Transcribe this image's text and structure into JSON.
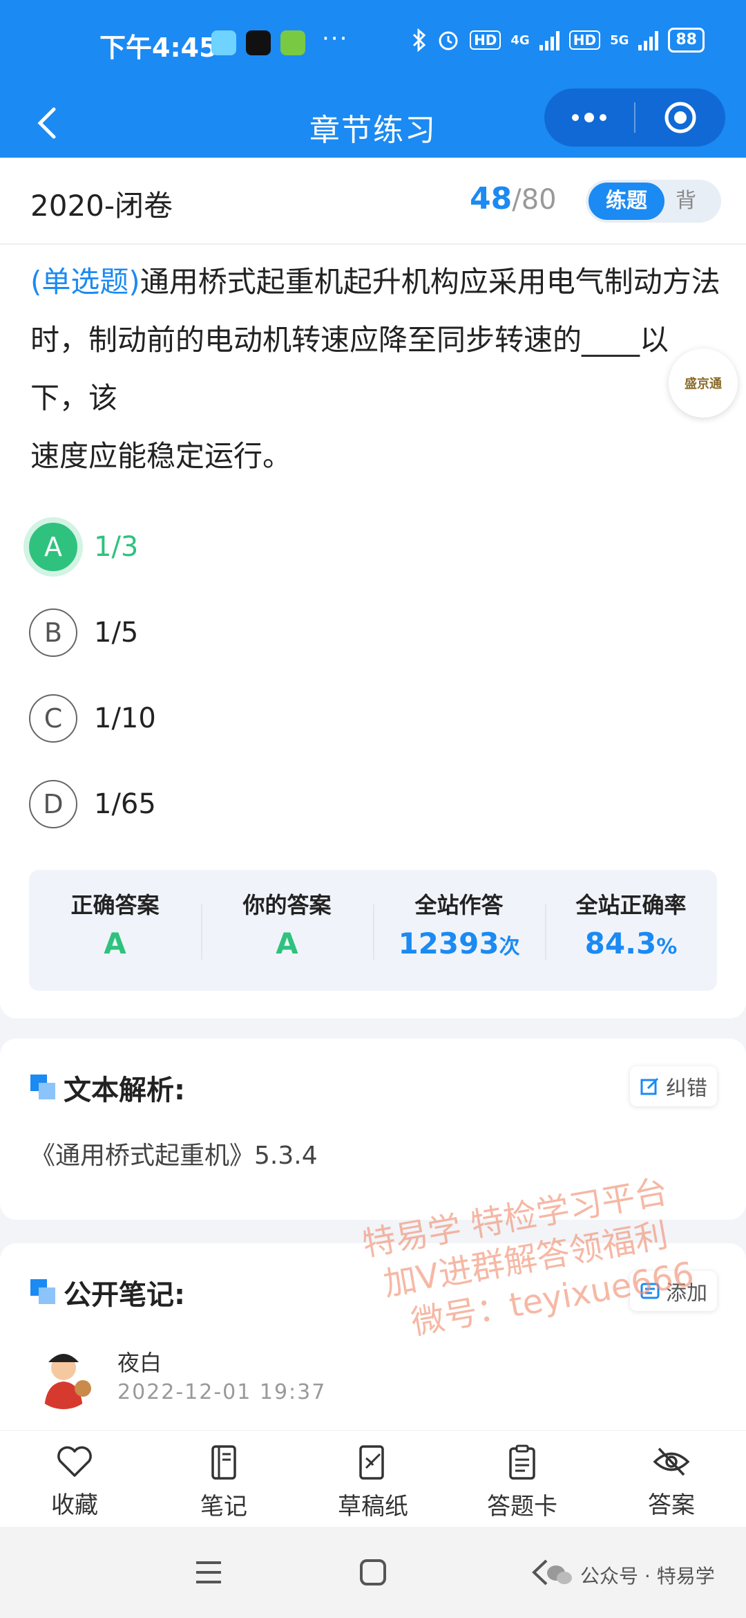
{
  "status_bar": {
    "time": "下午4:45",
    "dots": "···",
    "hd1": "HD",
    "net1": "4G",
    "hd2": "HD",
    "net2": "5G",
    "battery": "88"
  },
  "header": {
    "title": "章节练习",
    "back_icon": "chevron-left-icon",
    "more_icon": "more-dots-icon",
    "close_icon": "target-icon"
  },
  "subheader": {
    "paper_title": "2020-闭卷",
    "current": "48",
    "separator": "/",
    "total": "80",
    "mode_active": "练题",
    "mode_inactive": "背"
  },
  "question": {
    "type": "(单选题)",
    "text": "通用桥式起重机起升机构应采用电气制动方法时，制动前的电动机转速应降至同步转速的____以下，该",
    "text_line2": "速度应能稳定运行。"
  },
  "floating_badge": "盛京通",
  "options": [
    {
      "letter": "A",
      "text": "1/3",
      "correct": true
    },
    {
      "letter": "B",
      "text": "1/5",
      "correct": false
    },
    {
      "letter": "C",
      "text": "1/10",
      "correct": false
    },
    {
      "letter": "D",
      "text": "1/65",
      "correct": false
    }
  ],
  "stats": {
    "correct_label": "正确答案",
    "correct_value": "A",
    "yours_label": "你的答案",
    "yours_value": "A",
    "site_count_label": "全站作答",
    "site_count_value": "12393",
    "site_count_unit": "次",
    "site_rate_label": "全站正确率",
    "site_rate_value": "84.3",
    "site_rate_unit": "%"
  },
  "analysis": {
    "title": "文本解析:",
    "report_label": "纠错",
    "text": "《通用桥式起重机》5.3.4"
  },
  "notes": {
    "title": "公开笔记:",
    "add_label": "添加",
    "user": "夜白",
    "time": "2022-12-01 19:37"
  },
  "watermark": {
    "line1": "特易学 特检学习平台",
    "line2": "加V进群解答领福利",
    "line3": "微号：teyixue666"
  },
  "toolbar": {
    "items": [
      {
        "label": "收藏",
        "icon": "heart-icon"
      },
      {
        "label": "笔记",
        "icon": "notebook-icon"
      },
      {
        "label": "草稿纸",
        "icon": "draft-icon"
      },
      {
        "label": "答题卡",
        "icon": "clipboard-icon"
      },
      {
        "label": "答案",
        "icon": "eye-off-icon"
      }
    ]
  },
  "navbar": {
    "wechat_label": "公众号 · 特易学"
  },
  "colors": {
    "brand_blue": "#1b8af3",
    "correct_green": "#2ec27e"
  }
}
